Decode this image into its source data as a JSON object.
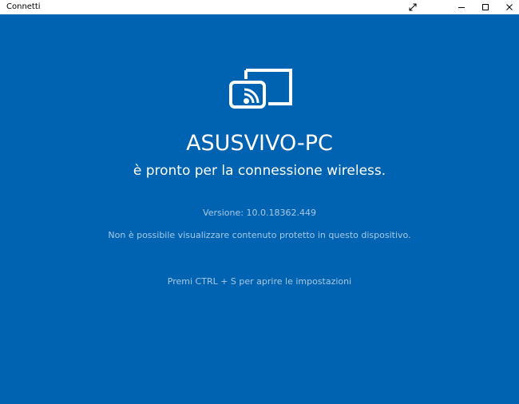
{
  "window": {
    "title": "Connetti",
    "controls": {
      "fullscreen_icon": "expand-arrows-icon",
      "minimize_icon": "minimize-icon",
      "maximize_icon": "maximize-icon",
      "close_icon": "close-icon"
    }
  },
  "colors": {
    "background": "#0063b1",
    "titlebar": "#ffffff",
    "primary_text": "#ffffff",
    "secondary_text": "#a9c9e6"
  },
  "main": {
    "icon": "wireless-project-icon",
    "device_name": "ASUSVIVO-PC",
    "ready_message": "è pronto per la connessione wireless.",
    "version": "Versione: 10.0.18362.449",
    "protected_content_notice": "Non è possibile visualizzare contenuto protetto in questo dispositivo.",
    "settings_hint": "Premi CTRL + S per aprire le impostazioni"
  }
}
